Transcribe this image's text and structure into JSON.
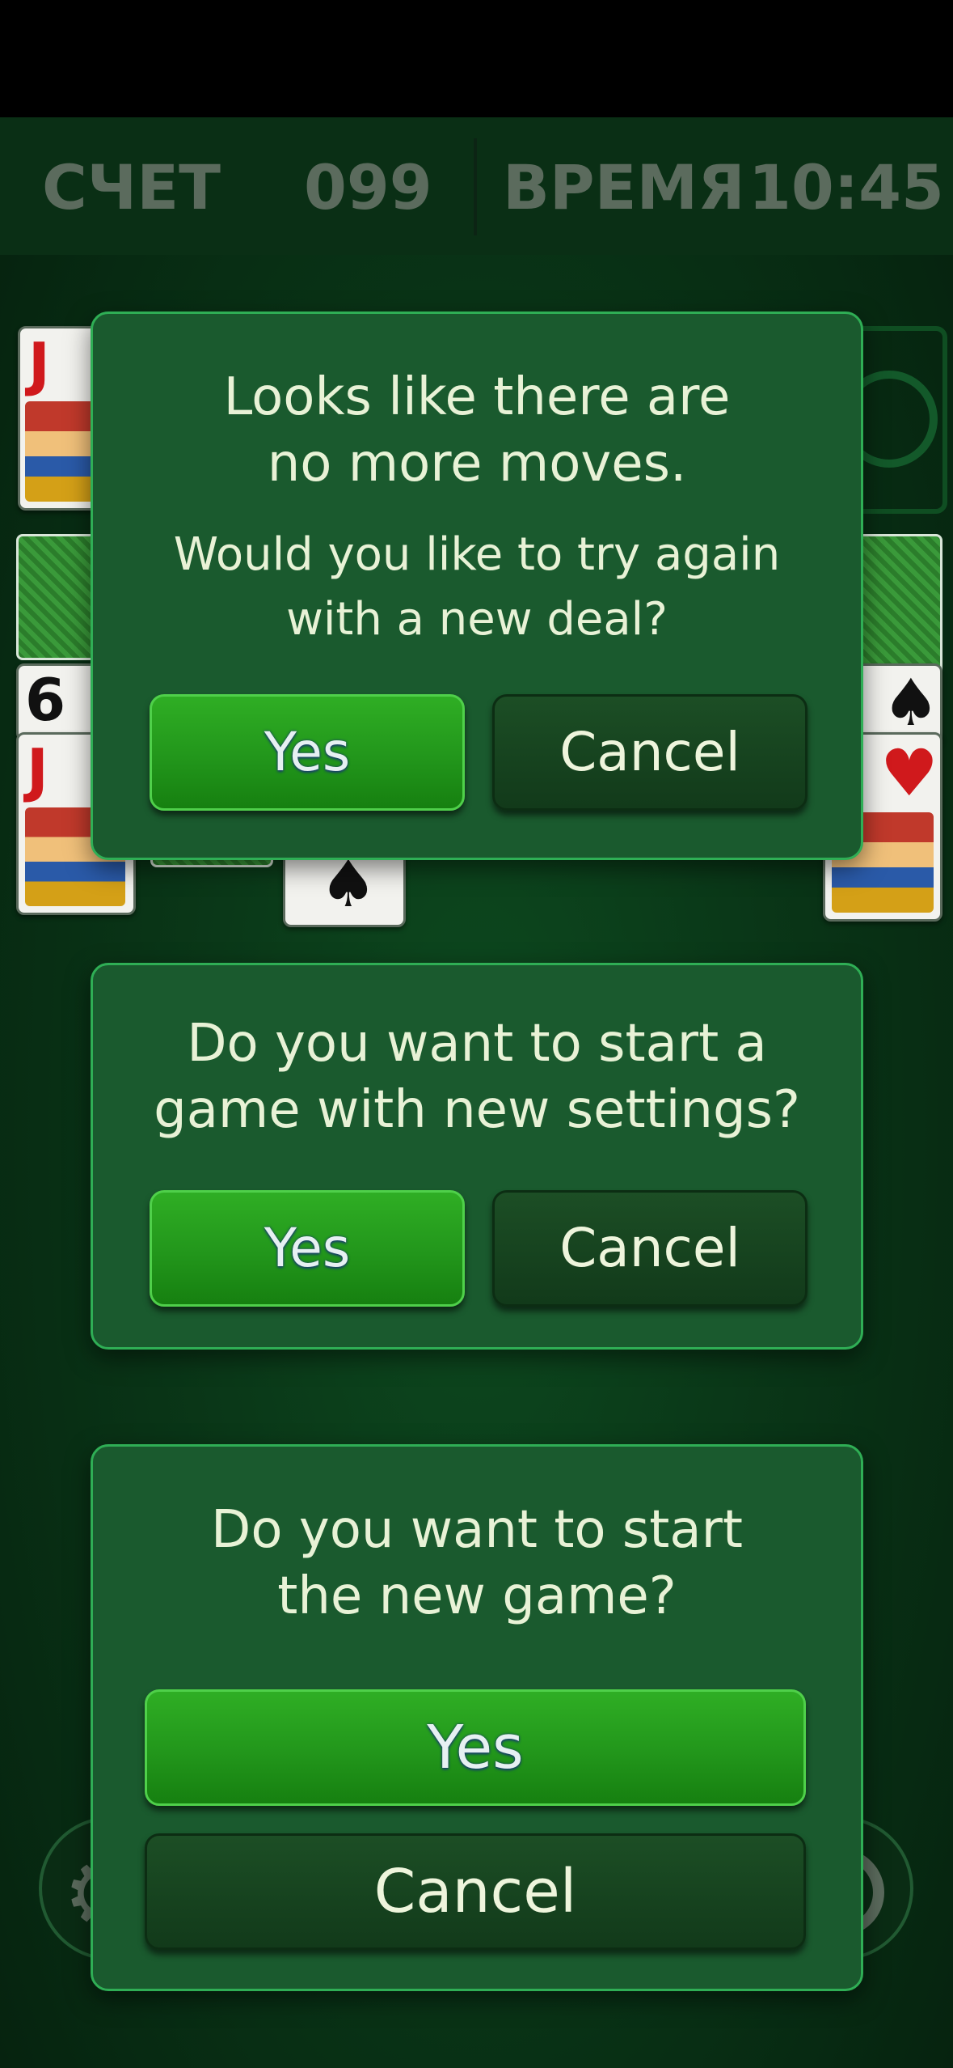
{
  "score_bar": {
    "score_label": "СЧЕТ",
    "score_value": "099",
    "time_label": "ВРЕМЯ",
    "time_value": "10:45"
  },
  "cards": {
    "jack_rank": "J",
    "six_rank": "6",
    "heart_suit": "♥",
    "spade_suit": "♠"
  },
  "dialog_no_moves": {
    "title": "Looks like there are\nno more moves.",
    "message": "Would you like to try again\nwith a new deal?",
    "yes_label": "Yes",
    "cancel_label": "Cancel"
  },
  "dialog_new_settings": {
    "message": "Do you want to start a\ngame with new settings?",
    "yes_label": "Yes",
    "cancel_label": "Cancel"
  },
  "dialog_new_game": {
    "message": "Do you want to start\nthe new game?",
    "yes_label": "Yes",
    "cancel_label": "Cancel"
  },
  "icons": {
    "settings": "gear-icon",
    "hint": "ring-icon"
  },
  "colors": {
    "accent_green": "#22961b",
    "dialog_bg": "#1a5a2e",
    "dialog_border": "#2fae55"
  }
}
